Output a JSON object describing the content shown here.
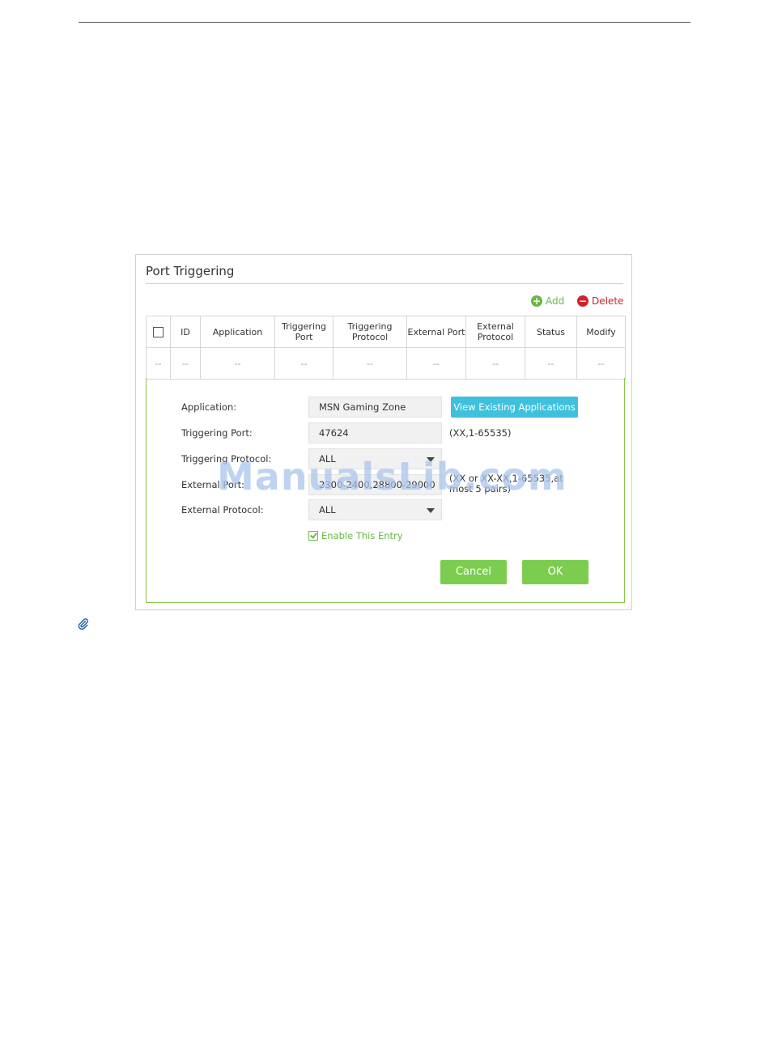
{
  "panel": {
    "title": "Port Triggering",
    "add_label": "Add",
    "delete_label": "Delete"
  },
  "table": {
    "headers": [
      "",
      "ID",
      "Application",
      "Triggering Port",
      "Triggering Protocol",
      "External Port",
      "External Protocol",
      "Status",
      "Modify"
    ],
    "row": [
      "--",
      "--",
      "--",
      "--",
      "--",
      "--",
      "--",
      "--",
      "--"
    ]
  },
  "form": {
    "application_label": "Application:",
    "application_value": "MSN Gaming Zone",
    "view_button": "View Existing Applications",
    "triggering_port_label": "Triggering Port:",
    "triggering_port_value": "47624",
    "triggering_port_hint": "(XX,1-65535)",
    "triggering_protocol_label": "Triggering Protocol:",
    "triggering_protocol_value": "ALL",
    "external_port_label": "External Port:",
    "external_port_value": "2300-2400,28800-29000",
    "external_port_hint_line1": "(XX or XX-XX,1-65535,at",
    "external_port_hint_line2": "most 5 pairs)",
    "external_protocol_label": "External Protocol:",
    "external_protocol_value": "ALL",
    "enable_label": "Enable This Entry",
    "enable_checked": true,
    "cancel_button": "Cancel",
    "ok_button": "OK"
  },
  "watermark": "ManualsLib.com",
  "icons": {
    "add": "plus-circle-icon",
    "delete": "minus-circle-icon",
    "note": "paperclip-icon"
  },
  "colors": {
    "accent_green": "#7ccd4f",
    "delete_red": "#d0242a",
    "view_button_blue": "#3fc0dd"
  }
}
